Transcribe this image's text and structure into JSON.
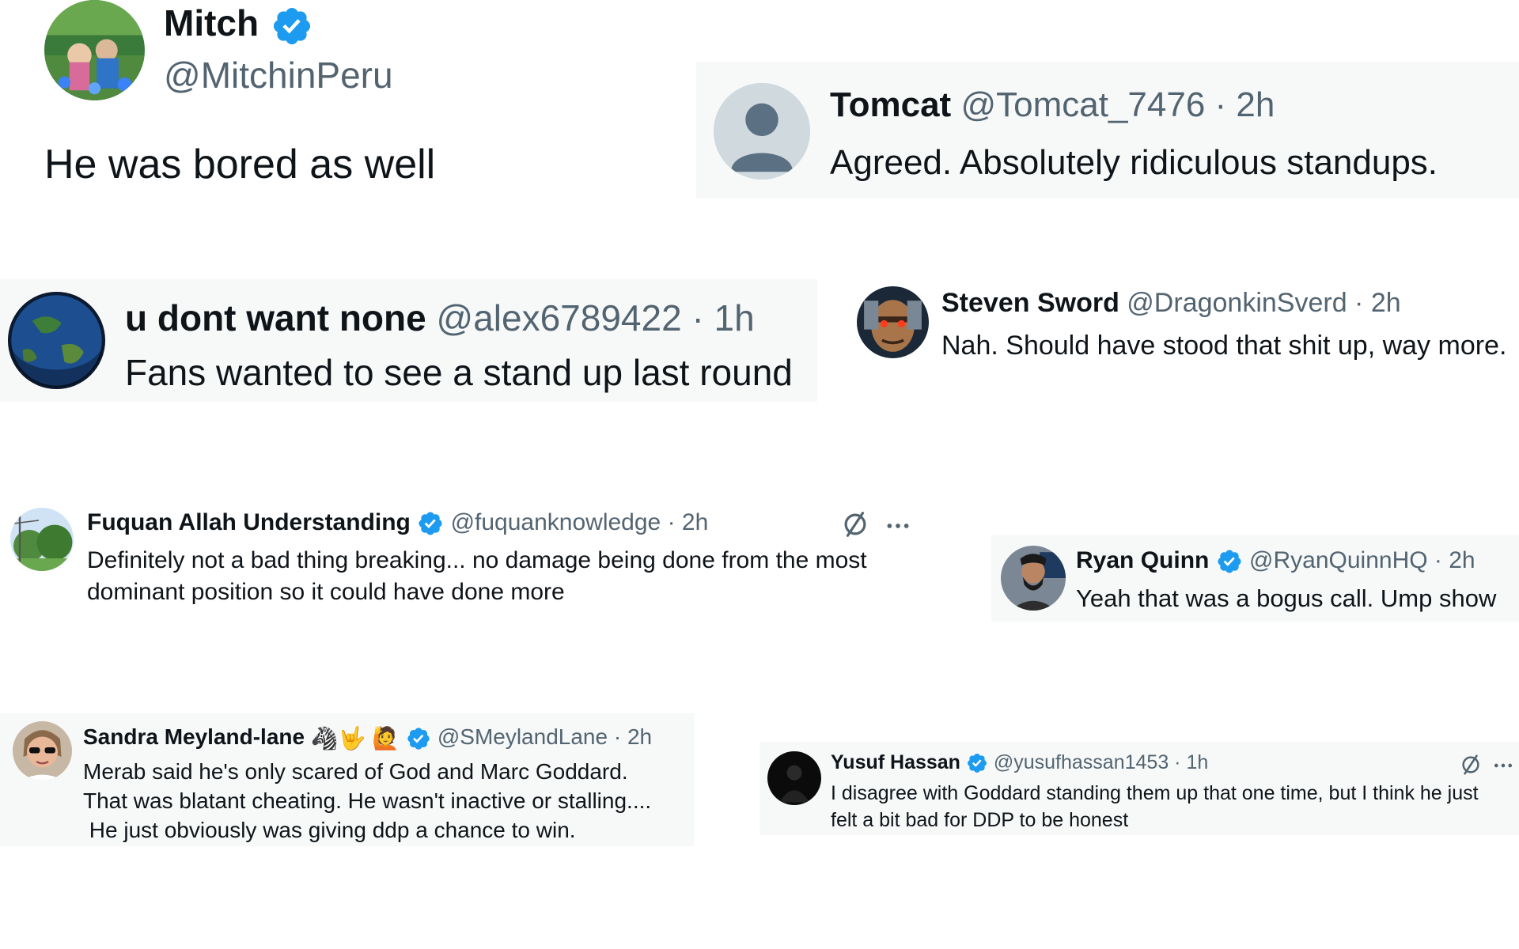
{
  "colors": {
    "verified_blue": "#1d9bf0",
    "handle_gray": "#536471",
    "text_dark": "#0f1419",
    "card_bg_light": "#f7f9f9"
  },
  "tweets": [
    {
      "author": "Mitch",
      "verified": true,
      "handle": "@MitchinPeru",
      "text": "He was bored as well",
      "avatar_icon": "family-photo-avatar"
    },
    {
      "author": "Tomcat",
      "verified": false,
      "handle": "@Tomcat_7476 · 2h",
      "text": "Agreed. Absolutely ridiculous standups.",
      "avatar_icon": "default-profile-avatar"
    },
    {
      "author": "u dont want none",
      "verified": false,
      "handle": "@alex6789422 · 1h",
      "text": "Fans wanted to see a stand up last round",
      "avatar_icon": "earth-avatar"
    },
    {
      "author": "Steven Sword",
      "verified": false,
      "handle": "@DragonkinSverd · 2h",
      "text": "Nah. Should have stood that shit up, way more.",
      "avatar_icon": "game-character-avatar"
    },
    {
      "author": "Fuquan Allah Understanding",
      "verified": true,
      "handle": "@fuquanknowledge · 2h",
      "text_lines": [
        "Definitely not a bad thing breaking... no damage being done from the most",
        "dominant position so it could have done more"
      ],
      "avatar_icon": "trees-avatar"
    },
    {
      "author": "Ryan Quinn",
      "verified": true,
      "handle": "@RyanQuinnHQ · 2h",
      "text": "Yeah that was a bogus call. Ump show",
      "avatar_icon": "bearded-man-avatar"
    },
    {
      "author": "Sandra Meyland-lane",
      "verified": true,
      "emojis": [
        "🦓",
        "🤟",
        "🙋"
      ],
      "handle": "@SMeylandLane · 2h",
      "text_lines": [
        "Merab said he's only scared of God and Marc Goddard.",
        "That was blatant cheating.  He wasn't inactive or stalling....",
        " He just obviously was giving ddp a chance to win."
      ],
      "avatar_icon": "woman-sunglasses-avatar"
    },
    {
      "author": "Yusuf Hassan",
      "verified": true,
      "handle": "@yusufhassan1453 · 1h",
      "text_lines": [
        "I disagree with Goddard standing them up that one time, but I think he just",
        "felt a bit bad for DDP to be honest"
      ],
      "avatar_icon": "dark-figure-avatar"
    }
  ]
}
